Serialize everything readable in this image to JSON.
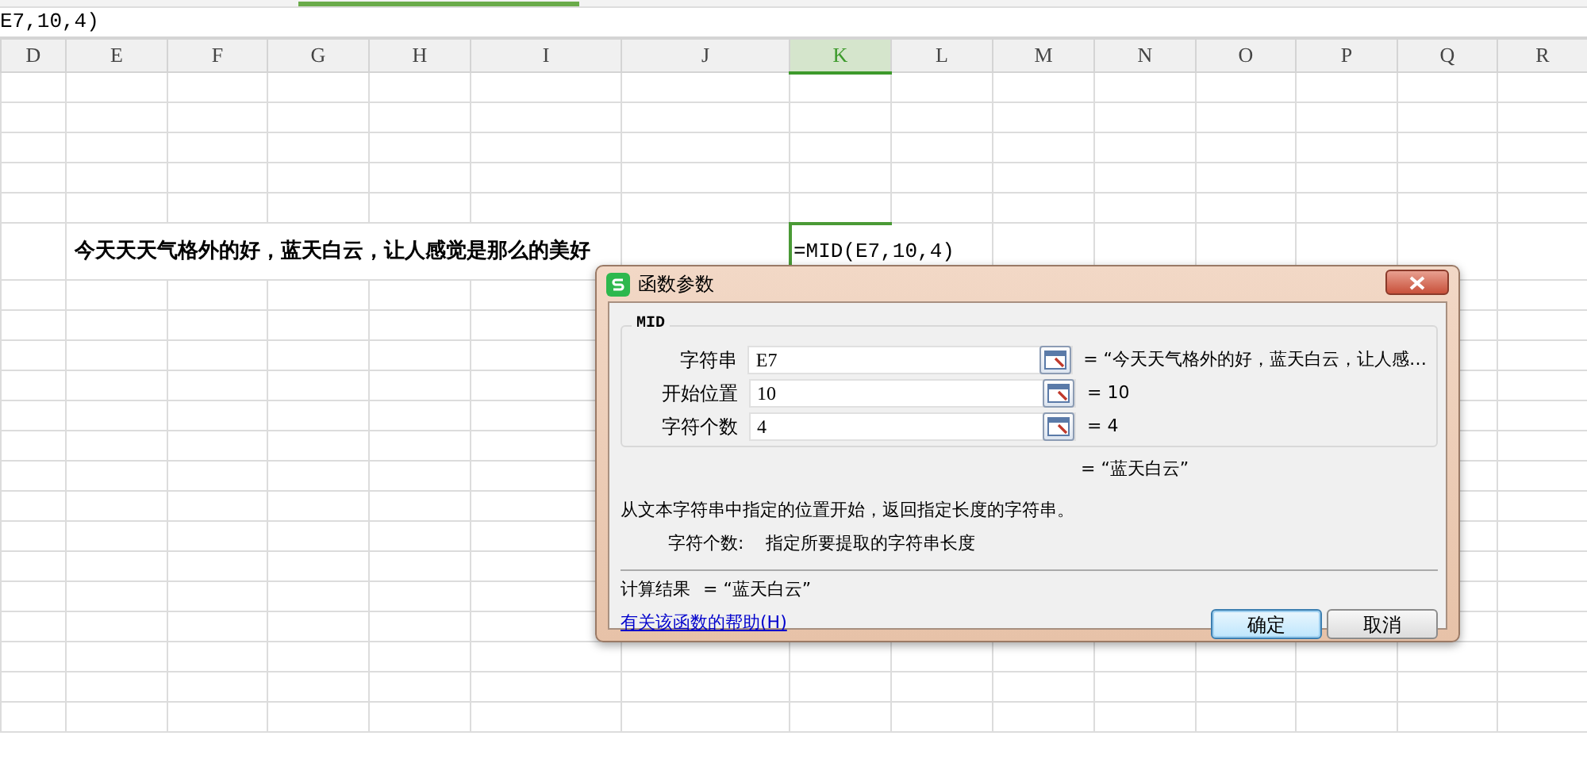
{
  "formula_bar": {
    "value": "E7,10,4)"
  },
  "columns": [
    {
      "label": "D",
      "selected": false
    },
    {
      "label": "E",
      "selected": false
    },
    {
      "label": "F",
      "selected": false
    },
    {
      "label": "G",
      "selected": false
    },
    {
      "label": "H",
      "selected": false
    },
    {
      "label": "I",
      "selected": false
    },
    {
      "label": "J",
      "selected": false
    },
    {
      "label": "K",
      "selected": true
    },
    {
      "label": "L",
      "selected": false
    },
    {
      "label": "M",
      "selected": false
    },
    {
      "label": "N",
      "selected": false
    },
    {
      "label": "O",
      "selected": false
    },
    {
      "label": "P",
      "selected": false
    },
    {
      "label": "Q",
      "selected": false
    },
    {
      "label": "R",
      "selected": false
    }
  ],
  "cells": [
    {
      "kind": "text",
      "text": "今天天天气格外的好，蓝天白云，让人感觉是那么的美好",
      "selected": false
    },
    {
      "kind": "formula",
      "text": "=MID(E7,10,4)",
      "selected": true
    }
  ],
  "dialog": {
    "title": "函数参数",
    "function_name": "MID",
    "arguments": [
      {
        "label": "字符串",
        "value": "E7",
        "equals": "=",
        "result": "“今天天气格外的好，蓝天白云，让人感…"
      },
      {
        "label": "开始位置",
        "value": "10",
        "equals": "=",
        "result": "10"
      },
      {
        "label": "字符个数",
        "value": "4",
        "equals": "=",
        "result": "4"
      }
    ],
    "function_result": "= “蓝天白云”",
    "description": "从文本字符串中指定的位置开始，返回指定长度的字符串。",
    "argument_help": {
      "label": "字符个数:",
      "text": "指定所要提取的字符串长度"
    },
    "calc_result": {
      "label": "计算结果",
      "value": "= “蓝天白云”"
    },
    "help_link": "有关该函数的帮助(H)",
    "buttons": [
      {
        "label": "确定",
        "default": true
      },
      {
        "label": "取消",
        "default": false
      }
    ]
  }
}
